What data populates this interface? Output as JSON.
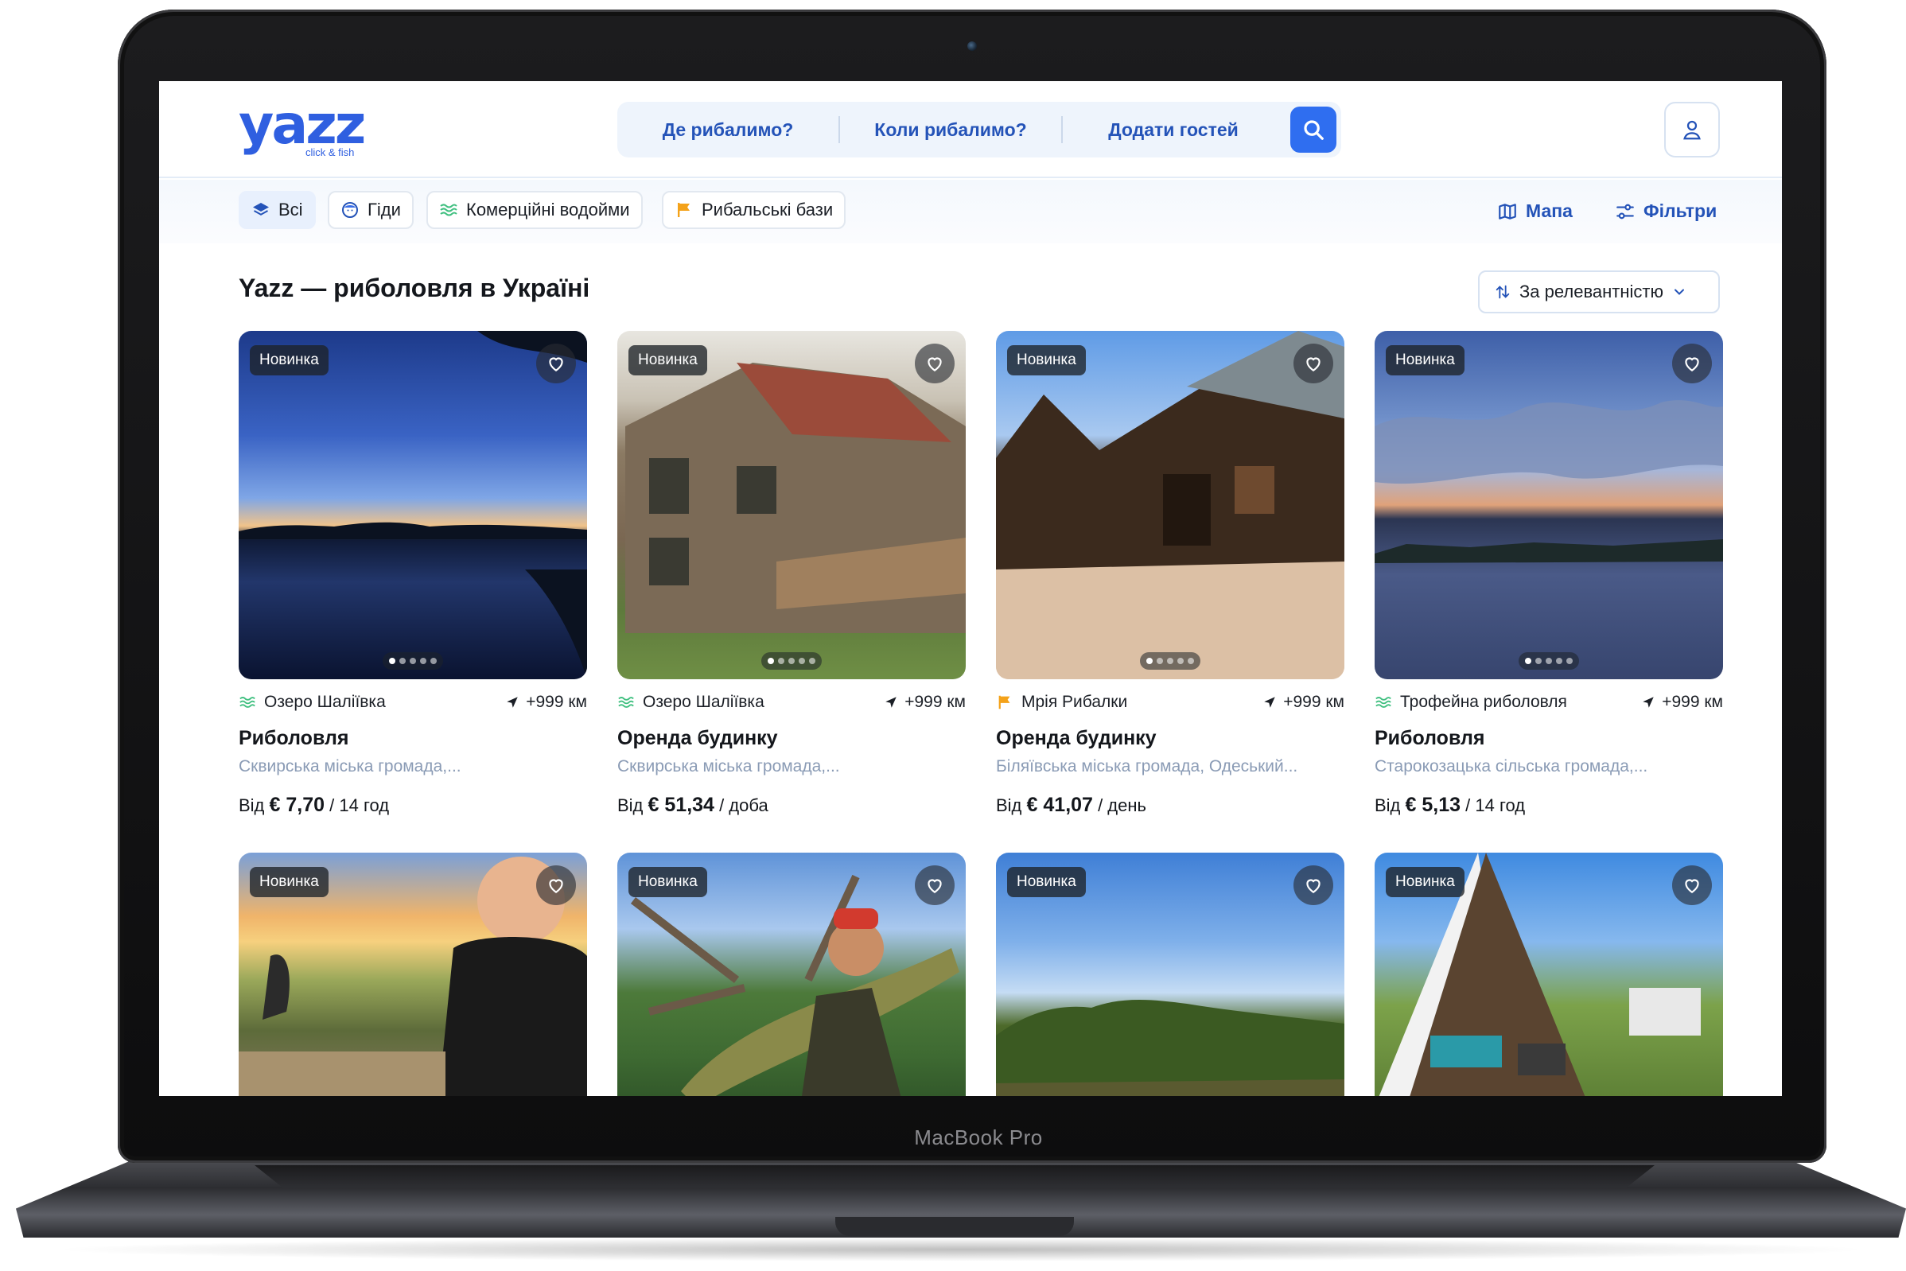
{
  "device": {
    "label": "MacBook Pro"
  },
  "header": {
    "logo": {
      "word": "yazz",
      "tagline": "click & fish"
    },
    "search": {
      "where": "Де рибалимо?",
      "when": "Коли рибалимо?",
      "guests": "Додати гостей"
    }
  },
  "filters": {
    "chips": [
      {
        "label": "Всі",
        "icon": "layers-icon",
        "active": true
      },
      {
        "label": "Гіди",
        "icon": "guide-face-icon",
        "active": false
      },
      {
        "label": "Комерційні водойми",
        "icon": "water-waves-icon",
        "active": false
      },
      {
        "label": "Рибальські бази",
        "icon": "flag-icon",
        "active": false
      }
    ],
    "map_label": "Мапа",
    "filters_label": "Фільтри"
  },
  "main": {
    "title": "Yazz — риболовля в Україні",
    "sort_label": "За релевантністю"
  },
  "cards": [
    {
      "badge": "Новинка",
      "place": "Озеро Шаліївка",
      "place_icon": "water-waves-icon",
      "distance": "+999 км",
      "title": "Риболовля",
      "subtitle": "Сквирська міська громада,...",
      "price_prefix": "Від",
      "price": "€ 7,70",
      "price_unit": "/ 14 год",
      "photo": "sunset-lake"
    },
    {
      "badge": "Новинка",
      "place": "Озеро Шаліївка",
      "place_icon": "water-waves-icon",
      "distance": "+999 км",
      "title": "Оренда будинку",
      "subtitle": "Сквирська міська громада,...",
      "price_prefix": "Від",
      "price": "€ 51,34",
      "price_unit": "/ доба",
      "photo": "wooden-house"
    },
    {
      "badge": "Новинка",
      "place": "Мрія Рибалки",
      "place_icon": "flag-icon",
      "distance": "+999 км",
      "title": "Оренда будинку",
      "subtitle": "Біляївська міська громада, Одеський...",
      "price_prefix": "Від",
      "price": "€ 41,07",
      "price_unit": "/ день",
      "photo": "log-cabin"
    },
    {
      "badge": "Новинка",
      "place": "Трофейна риболовля",
      "place_icon": "water-waves-icon",
      "distance": "+999 км",
      "title": "Риболовля",
      "subtitle": "Старокозацька сільська громада,...",
      "price_prefix": "Від",
      "price": "€ 5,13",
      "price_unit": "/ 14 год",
      "photo": "cloudy-lake"
    },
    {
      "badge": "Новинка",
      "photo": "fisher-sunset"
    },
    {
      "badge": "Новинка",
      "photo": "pike-catch"
    },
    {
      "badge": "Новинка",
      "photo": "forest-lake"
    },
    {
      "badge": "Новинка",
      "photo": "a-frame-house"
    }
  ],
  "colors": {
    "accent": "#2f6ef0",
    "link": "#2453b8",
    "muted": "#8a9bb5",
    "water_icon": "#3fbf7f",
    "flag_icon": "#f4a21a"
  }
}
